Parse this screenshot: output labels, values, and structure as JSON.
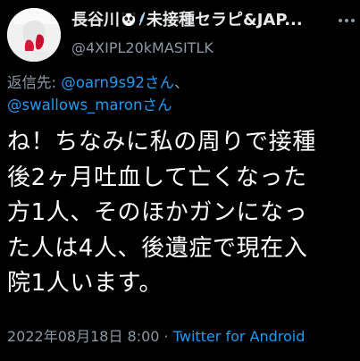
{
  "author": {
    "name_prefix": "長谷川",
    "name_suffix": "未接種セラピ&JAP...",
    "handle": "@4XIPL20kMASITLK",
    "avatar_icon": "avatar-photo-icon"
  },
  "reply": {
    "prefix": "返信先: ",
    "mention_1": "@oarn9s92さん",
    "separator": "、",
    "mention_2": "@swallows_maronさん"
  },
  "tweet": {
    "text": "ね！ちなみに私の周りで接種\n後2ヶ月吐血して亡くなった\n方1人、そのほかガンになっ\nた人は4人、後遺症で現在入\n院1人います。"
  },
  "meta": {
    "timestamp": "2022年08月18日 8:00",
    "dot": " · ",
    "source": "Twitter for Android"
  },
  "colors": {
    "background": "#000000",
    "text": "#ffffff",
    "secondary": "#8b98a5",
    "accent": "#1d9bf0"
  }
}
